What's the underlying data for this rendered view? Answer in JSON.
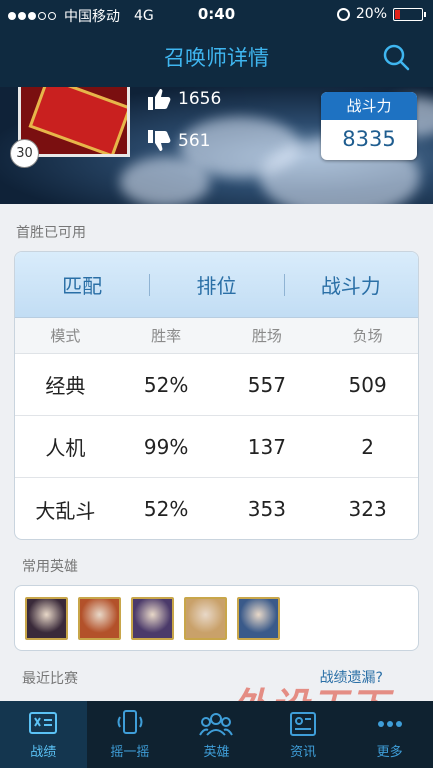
{
  "status_bar": {
    "carrier": "中国移动",
    "network": "4G",
    "time": "0:40",
    "battery": "20%",
    "battery_level": 0.2
  },
  "nav": {
    "title": "召唤师详情"
  },
  "summoner": {
    "level": "30",
    "likes": "1656",
    "dislikes": "561",
    "power_label": "战斗力",
    "power_value": "8335"
  },
  "first_win_text": "首胜已可用",
  "stats": {
    "tabs": [
      "匹配",
      "排位",
      "战斗力"
    ],
    "columns": [
      "模式",
      "胜率",
      "胜场",
      "负场"
    ],
    "rows": [
      [
        "经典",
        "52%",
        "557",
        "509"
      ],
      [
        "人机",
        "99%",
        "137",
        "2"
      ],
      [
        "大乱斗",
        "52%",
        "353",
        "323"
      ]
    ]
  },
  "common_heroes": {
    "label": "常用英雄",
    "heroes": [
      {
        "icon": "hero-1-avatar",
        "color": "#3a2a3a"
      },
      {
        "icon": "hero-2-avatar",
        "color": "#b3512a"
      },
      {
        "icon": "hero-3-avatar",
        "color": "#4b3a6a"
      },
      {
        "icon": "hero-4-avatar",
        "color": "#c9a16a"
      },
      {
        "icon": "hero-5-avatar",
        "color": "#3a5a8a"
      }
    ]
  },
  "recent": {
    "label": "最近比赛",
    "missing_link": "战绩遗漏?"
  },
  "tabbar": [
    {
      "label": "战绩",
      "icon": "record-icon",
      "active": true
    },
    {
      "label": "摇一摇",
      "icon": "shake-icon",
      "active": false
    },
    {
      "label": "英雄",
      "icon": "heroes-icon",
      "active": false
    },
    {
      "label": "资讯",
      "icon": "news-icon",
      "active": false
    },
    {
      "label": "更多",
      "icon": "more-icon",
      "active": false
    }
  ],
  "watermark": {
    "text": "外设天下",
    "url": "waishe.cn"
  },
  "colors": {
    "accent": "#3fb6f0",
    "navbar": "#0f2a40",
    "power_header": "#1e72c2"
  }
}
